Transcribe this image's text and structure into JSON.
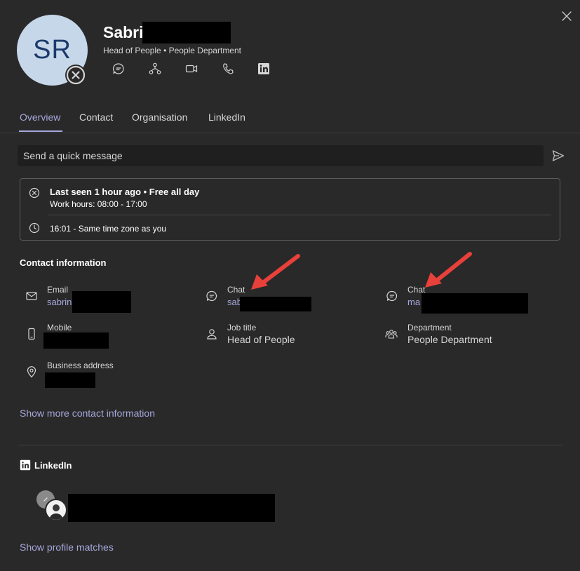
{
  "profile": {
    "initials": "SR",
    "name_visible": "Sabri",
    "subtitle": "Head of People • People Department"
  },
  "header_actions": [
    "chat-icon",
    "org-chart-icon",
    "video-call-icon",
    "phone-icon",
    "linkedin-icon"
  ],
  "tabs": [
    {
      "label": "Overview",
      "active": true
    },
    {
      "label": "Contact",
      "active": false
    },
    {
      "label": "Organisation",
      "active": false
    },
    {
      "label": "LinkedIn",
      "active": false
    }
  ],
  "quick_message": {
    "placeholder": "Send a quick message"
  },
  "availability": {
    "status": "Last seen 1 hour ago • Free all day",
    "work_hours": "Work hours: 08:00 - 17:00",
    "timezone": "16:01 - Same time zone as you"
  },
  "contact": {
    "title": "Contact information",
    "email": {
      "label": "Email",
      "value": "sabrin"
    },
    "chat1": {
      "label": "Chat",
      "value": "sab"
    },
    "chat2": {
      "label": "Chat",
      "value": "ma"
    },
    "mobile": {
      "label": "Mobile"
    },
    "job_title": {
      "label": "Job title",
      "value": "Head of People"
    },
    "department": {
      "label": "Department",
      "value": "People Department"
    },
    "address": {
      "label": "Business address"
    },
    "show_more": "Show more contact information"
  },
  "linkedin": {
    "title": "LinkedIn",
    "show_matches": "Show profile matches"
  },
  "colors": {
    "background": "#292929",
    "accent": "#a6a7dc",
    "avatar_bg": "#c7d7ea",
    "annotation_arrow": "#e8403a"
  }
}
